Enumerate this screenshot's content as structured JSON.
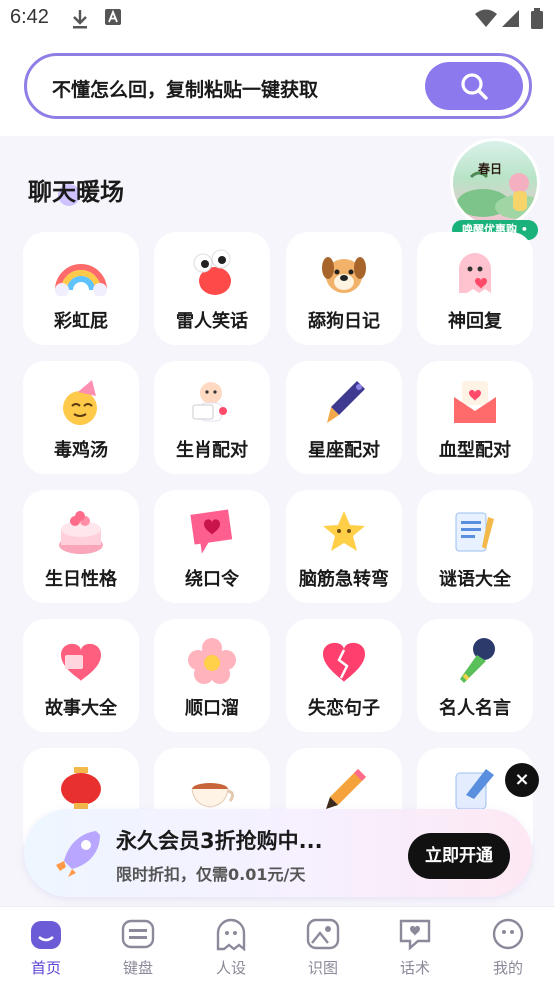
{
  "status_bar": {
    "time": "6:42"
  },
  "search": {
    "placeholder": "不懂怎么回，复制粘贴一键获取"
  },
  "section": {
    "title": "聊天暖场"
  },
  "promo": {
    "mini_text": "春日",
    "pill": "唤醒优惠购 •"
  },
  "features": [
    {
      "label": "彩虹屁",
      "icon": "rainbow-icon"
    },
    {
      "label": "雷人笑话",
      "icon": "silly-face-icon"
    },
    {
      "label": "舔狗日记",
      "icon": "dog-icon"
    },
    {
      "label": "神回复",
      "icon": "ghost-heart-icon"
    },
    {
      "label": "毒鸡汤",
      "icon": "party-face-icon"
    },
    {
      "label": "生肖配对",
      "icon": "baby-letter-icon"
    },
    {
      "label": "星座配对",
      "icon": "pen-icon"
    },
    {
      "label": "血型配对",
      "icon": "love-letter-icon"
    },
    {
      "label": "生日性格",
      "icon": "cake-icon"
    },
    {
      "label": "绕口令",
      "icon": "chat-heart-icon"
    },
    {
      "label": "脑筋急转弯",
      "icon": "star-icon"
    },
    {
      "label": "谜语大全",
      "icon": "notepad-icon"
    },
    {
      "label": "故事大全",
      "icon": "heart-book-icon"
    },
    {
      "label": "顺口溜",
      "icon": "flower-icon"
    },
    {
      "label": "失恋句子",
      "icon": "broken-heart-icon"
    },
    {
      "label": "名人名言",
      "icon": "microphone-icon"
    },
    {
      "label": "",
      "icon": "lantern-icon"
    },
    {
      "label": "",
      "icon": "tea-cup-icon"
    },
    {
      "label": "",
      "icon": "pencil-icon"
    },
    {
      "label": "",
      "icon": "memo-icon"
    }
  ],
  "vip": {
    "title": "永久会员3折抢购中...",
    "subtitle": "限时折扣，仅需0.01元/天",
    "button": "立即开通",
    "close": "×"
  },
  "tabs": [
    {
      "label": "首页",
      "icon": "home-icon"
    },
    {
      "label": "键盘",
      "icon": "keyboard-icon"
    },
    {
      "label": "人设",
      "icon": "ghost-icon"
    },
    {
      "label": "识图",
      "icon": "image-icon"
    },
    {
      "label": "话术",
      "icon": "heart-chat-icon"
    },
    {
      "label": "我的",
      "icon": "profile-icon"
    }
  ],
  "colors": {
    "accent": "#8c79ee",
    "active_tab": "#5b45d6",
    "badge_green": "#19b27a"
  }
}
